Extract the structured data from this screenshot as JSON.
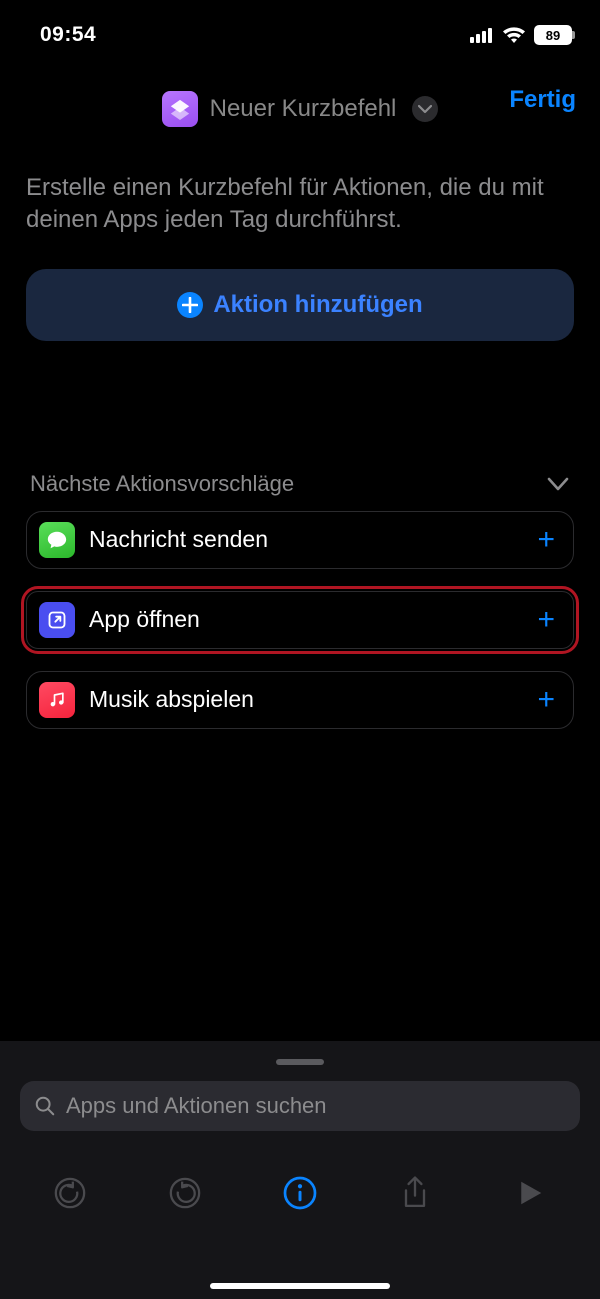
{
  "status": {
    "time": "09:54",
    "battery_pct": "89"
  },
  "header": {
    "title": "Neuer Kurzbefehl",
    "done": "Fertig"
  },
  "hint": "Erstelle einen Kurzbefehl für Aktionen, die du mit deinen Apps jeden Tag durchführst.",
  "add_action_label": "Aktion hinzufügen",
  "suggestions": {
    "title": "Nächste Aktionsvorschläge",
    "items": [
      {
        "label": "Nachricht senden",
        "icon": "messages",
        "highlight": false
      },
      {
        "label": "App öffnen",
        "icon": "open-app",
        "highlight": true
      },
      {
        "label": "Musik abspielen",
        "icon": "music",
        "highlight": false
      }
    ]
  },
  "search_placeholder": "Apps und Aktionen suchen"
}
